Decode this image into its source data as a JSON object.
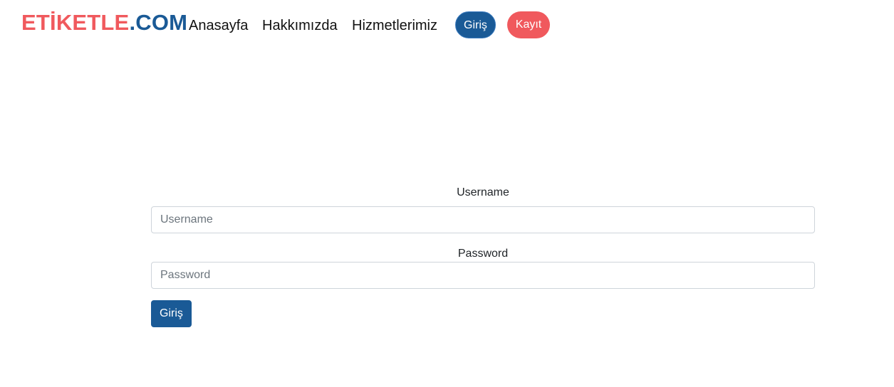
{
  "brand": {
    "part1": "ETİKETLE",
    "part2": ".COM",
    "color1": "#f0595d",
    "color2": "#1a5a96"
  },
  "nav": {
    "home": "Anasayfa",
    "about": "Hakkımızda",
    "services": "Hizmetlerimiz",
    "login": "Giriş",
    "register": "Kayıt"
  },
  "form": {
    "username_label": "Username",
    "username_placeholder": "Username",
    "password_label": "Password",
    "password_placeholder": "Password",
    "submit_label": "Giriş"
  },
  "colors": {
    "primary": "#1a5a96",
    "accent": "#f0595d"
  }
}
